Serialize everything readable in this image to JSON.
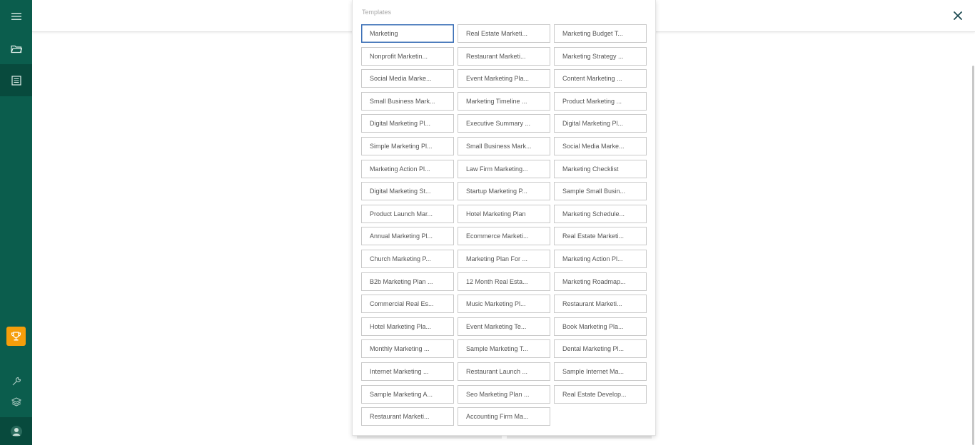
{
  "sidebar": {
    "items": [
      {
        "icon": "hamburger-menu-icon"
      },
      {
        "icon": "folder-icon"
      },
      {
        "icon": "document-list-icon"
      },
      {
        "icon": "trophy-icon"
      },
      {
        "icon": "wrench-icon"
      },
      {
        "icon": "layers-icon"
      },
      {
        "icon": "avatar-icon"
      }
    ],
    "accent": "#0b5d4d",
    "trophy_color": "#f59e0b"
  },
  "header": {
    "close_icon": "close-icon"
  },
  "templates": {
    "title": "Templates",
    "selected_index": 0,
    "items": [
      "Marketing",
      "Real Estate Marketi...",
      "Marketing Budget T...",
      "Nonprofit Marketin...",
      "Restaurant Marketi...",
      "Marketing Strategy ...",
      "Social Media Marke...",
      "Event Marketing Pla...",
      "Content Marketing ...",
      "Small Business Mark...",
      "Marketing Timeline ...",
      "Product Marketing ...",
      "Digital Marketing Pl...",
      "Executive Summary ...",
      "Digital Marketing Pl...",
      "Simple Marketing Pl...",
      "Small Business Mark...",
      "Social Media Marke...",
      "Marketing Action Pl...",
      "Law Firm Marketing...",
      "Marketing Checklist",
      "Digital Marketing St...",
      "Startup Marketing P...",
      "Sample Small Busin...",
      "Product Launch Mar...",
      "Hotel Marketing Plan",
      "Marketing Schedule...",
      "Annual Marketing Pl...",
      "Ecommerce Marketi...",
      "Real Estate Marketi...",
      "Church Marketing P...",
      "Marketing Plan For ...",
      "Marketing Action Pl...",
      "B2b Marketing Plan ...",
      "12 Month Real Esta...",
      "Marketing Roadmap...",
      "Commercial Real Es...",
      "Music Marketing Pl...",
      "Restaurant Marketi...",
      "Hotel Marketing Pla...",
      "Event Marketing Te...",
      "Book Marketing Pla...",
      "Monthly Marketing ...",
      "Sample Marketing T...",
      "Dental Marketing Pl...",
      "Internet Marketing ...",
      "Restaurant Launch ...",
      "Sample Internet Ma...",
      "Sample Marketing A...",
      "Seo Marketing Plan ...",
      "Real Estate Develop...",
      "Restaurant Marketi...",
      "Accounting Firm Ma..."
    ]
  }
}
